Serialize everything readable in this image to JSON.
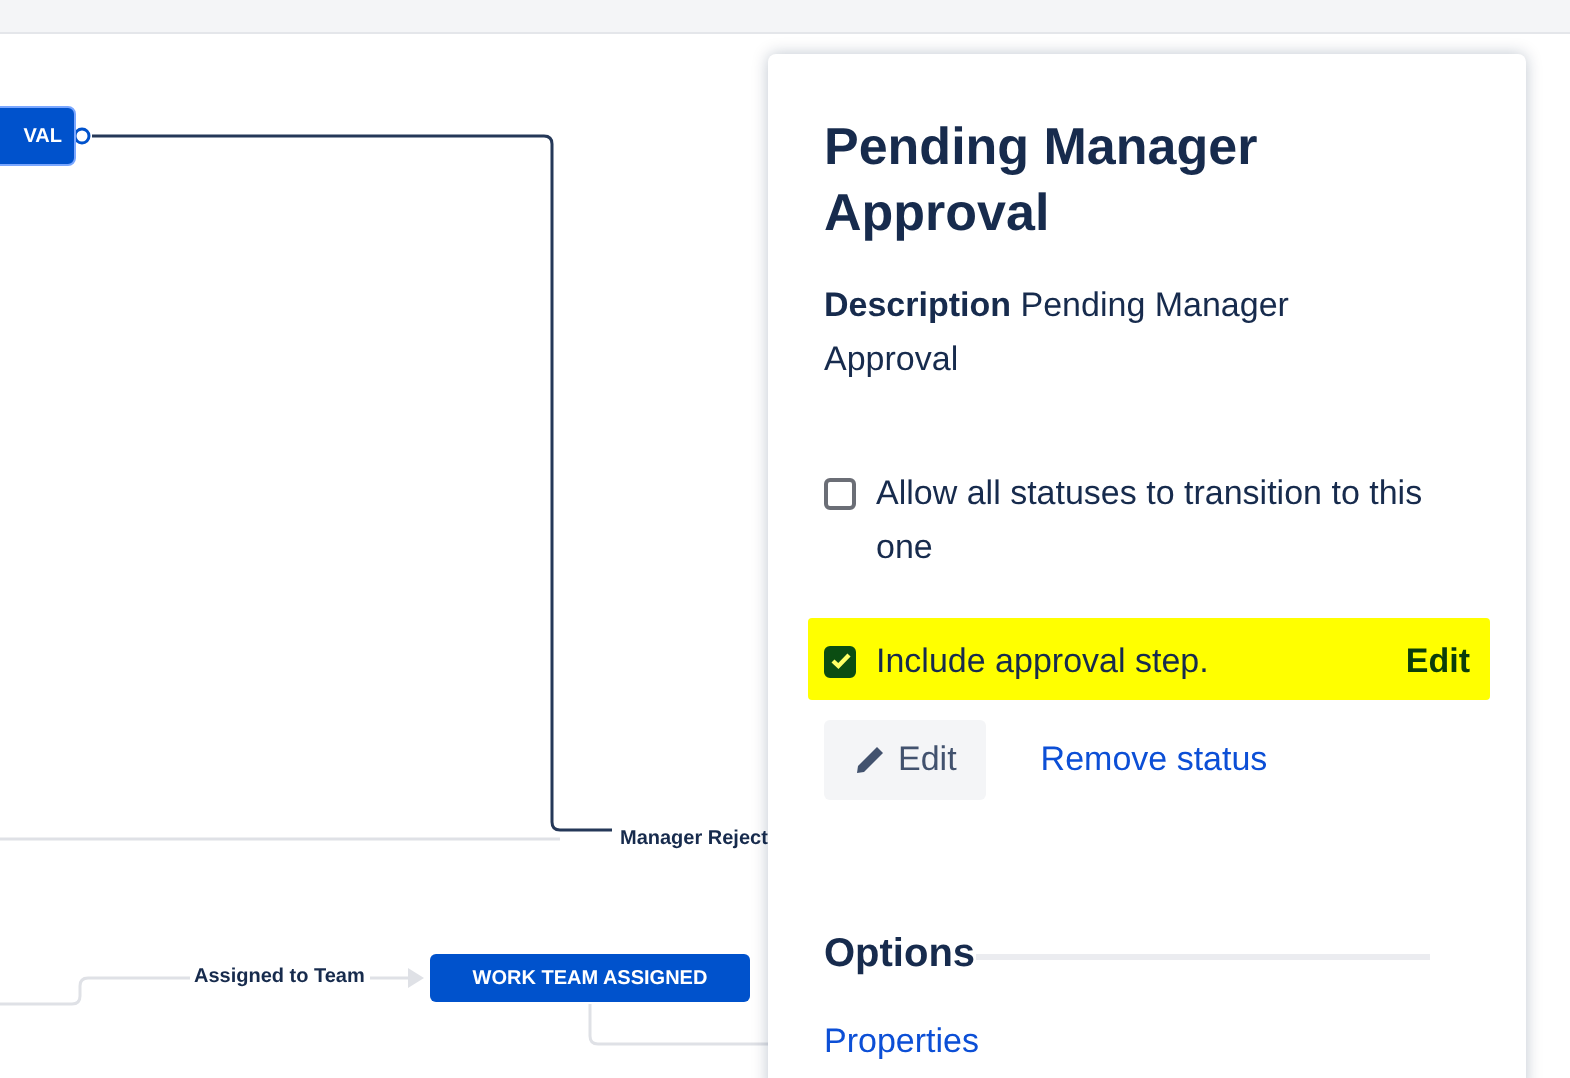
{
  "canvas": {
    "nodes": [
      {
        "label": "VAL",
        "selected": true
      },
      {
        "label": "WORK TEAM ASSIGNED",
        "selected": false
      }
    ],
    "transitions": [
      {
        "label": "Manager Reject"
      },
      {
        "label": "Assigned to Team"
      }
    ]
  },
  "panel": {
    "title": "Pending Manager Approval",
    "description_label": "Description",
    "description": "Pending Manager Approval",
    "options": [
      {
        "label": "Allow all statuses to transition to this one",
        "checked": false,
        "highlighted": false
      },
      {
        "label": "Include approval step.",
        "checked": true,
        "highlighted": true,
        "action": "Edit"
      }
    ],
    "buttons": [
      {
        "label": "Edit",
        "kind": "button"
      },
      {
        "label": "Remove status",
        "kind": "link"
      }
    ],
    "section_title": "Options",
    "links": [
      "Properties"
    ]
  }
}
